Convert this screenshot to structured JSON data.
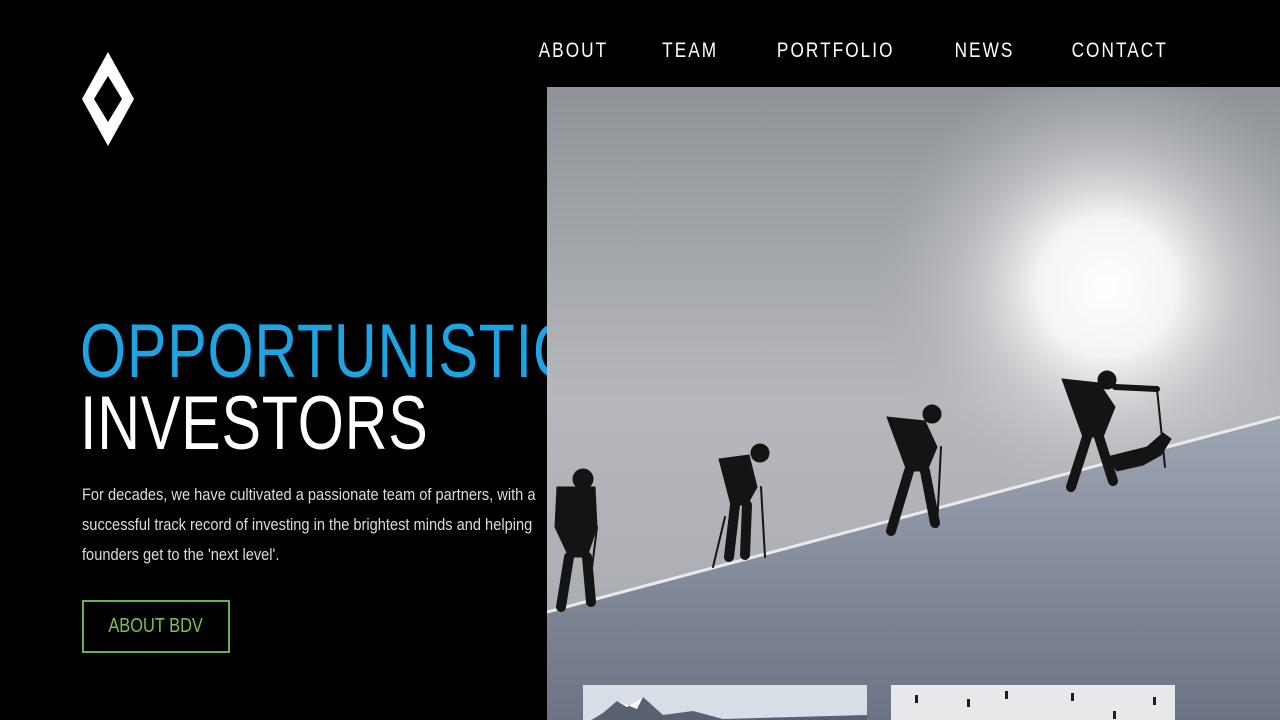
{
  "nav": {
    "items": [
      {
        "label": "ABOUT"
      },
      {
        "label": "TEAM"
      },
      {
        "label": "PORTFOLIO"
      },
      {
        "label": "NEWS"
      },
      {
        "label": "CONTACT"
      }
    ]
  },
  "hero": {
    "headline_line1": "OPPORTUNISTIC",
    "headline_line2": "INVESTORS",
    "intro": "For decades, we have cultivated a passionate team of partners, with a successful track record of investing in the brightest minds and helping founders get to the 'next level'.",
    "cta_label": "ABOUT BDV"
  },
  "icons": {
    "logo": "diamond-logo-icon"
  },
  "colors": {
    "background": "#000000",
    "accent_blue": "#1ea4e2",
    "accent_green": "#7cc152",
    "text_white": "#ffffff"
  }
}
